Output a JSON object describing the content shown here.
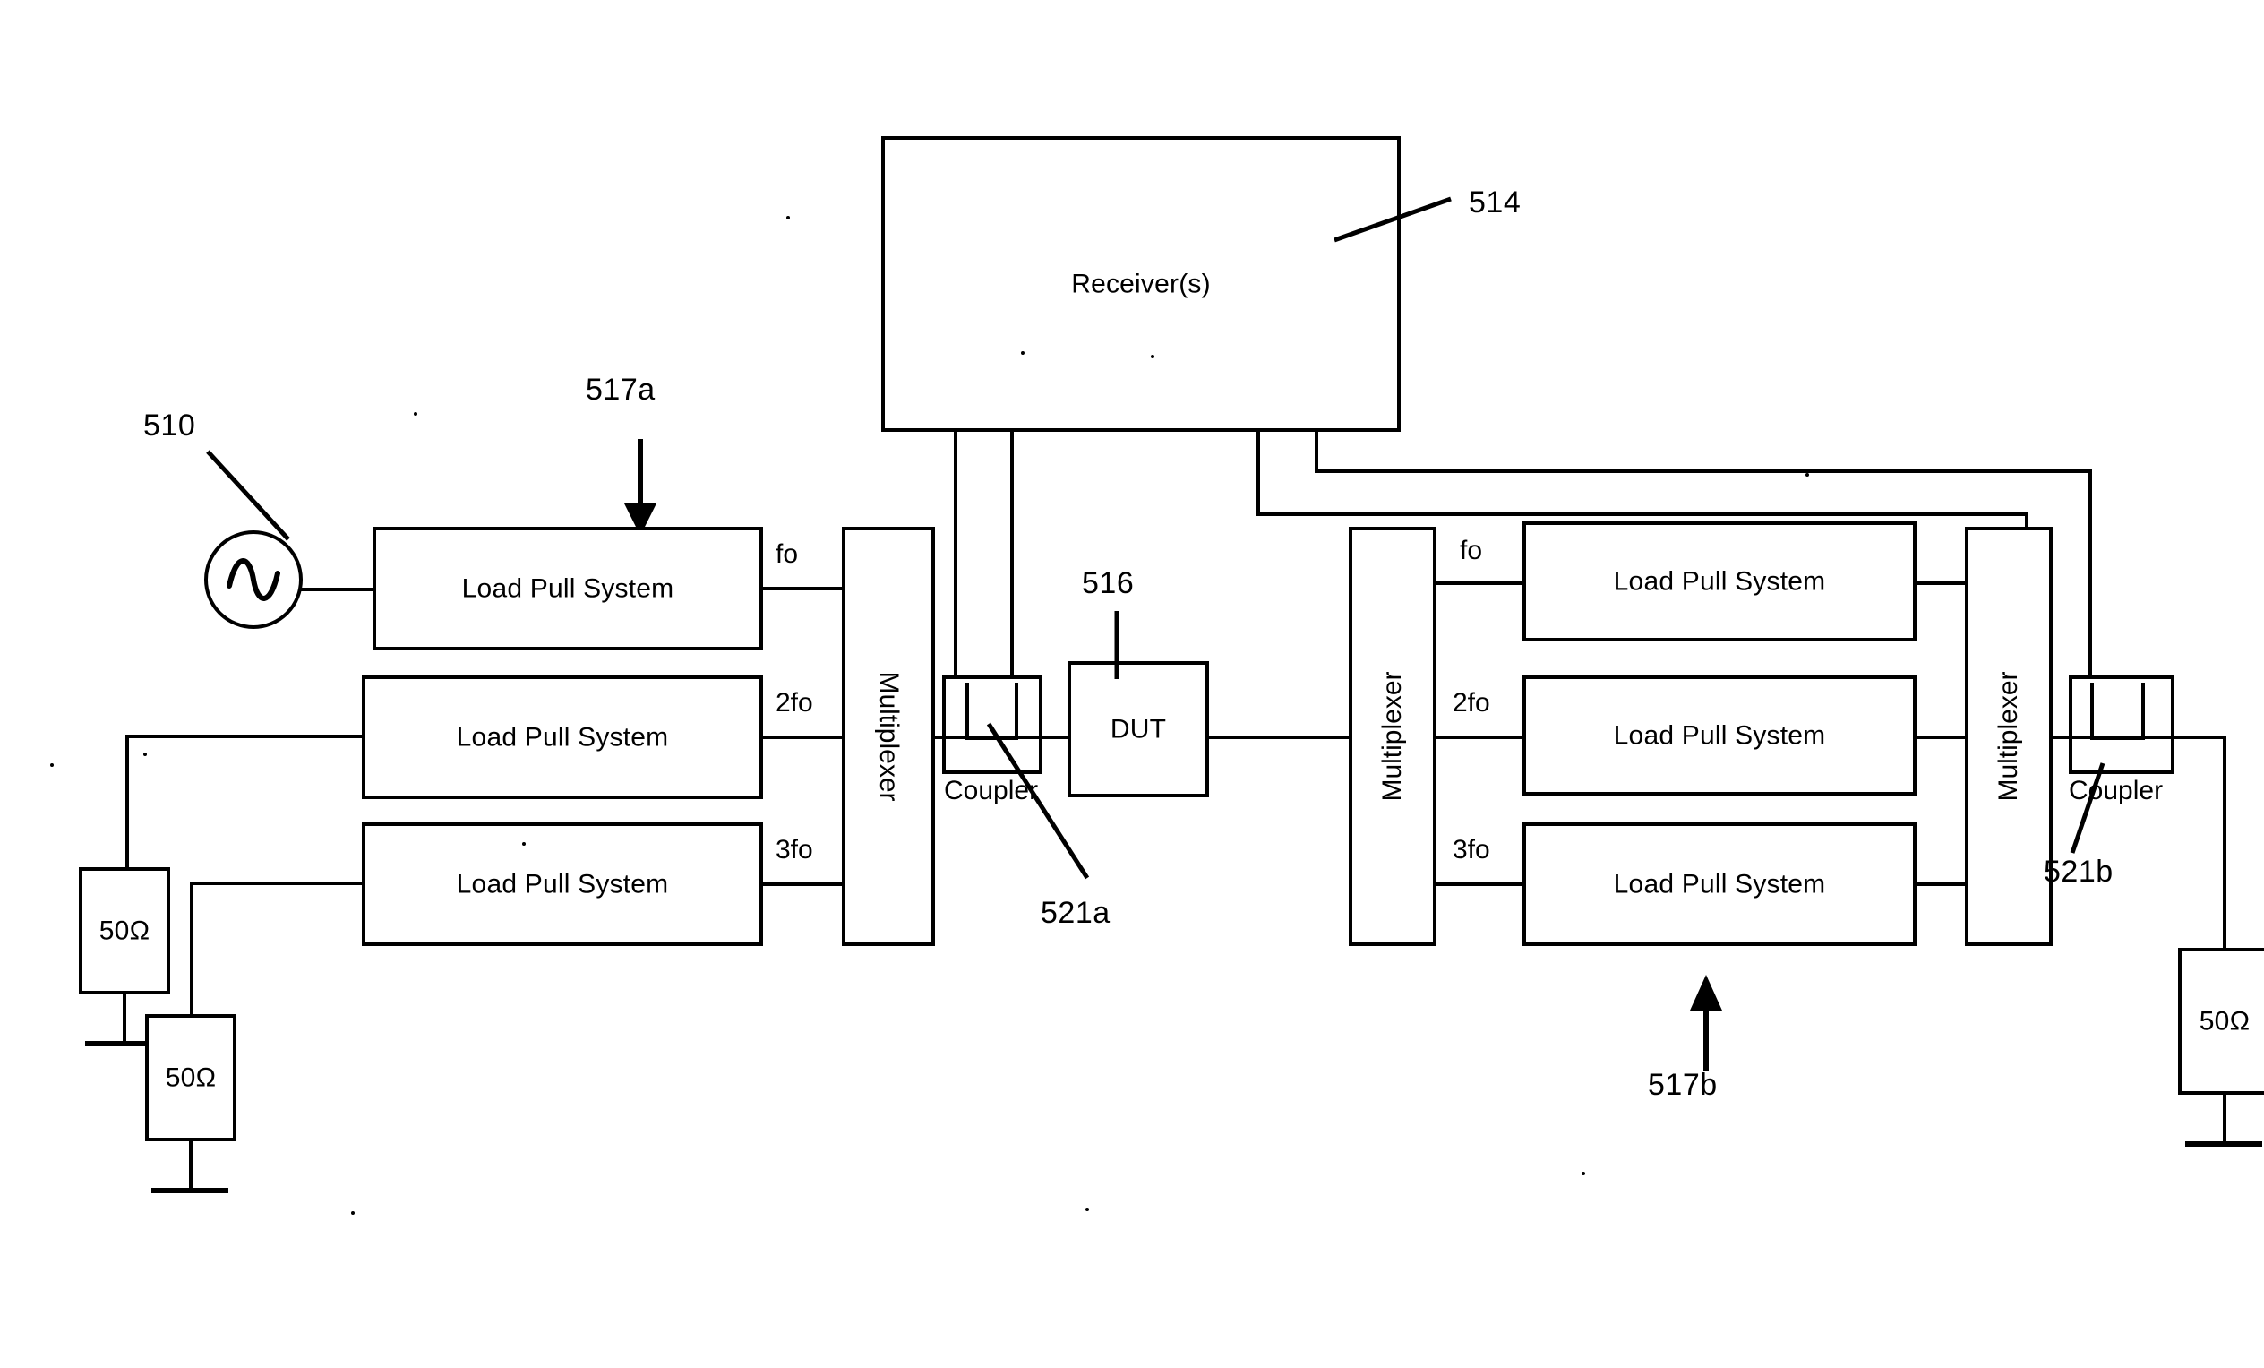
{
  "figure": {
    "kind": "patent-block-diagram",
    "reference_numerals": [
      {
        "id": "510",
        "label": "510",
        "points_to": "signal-source"
      },
      {
        "id": "514",
        "label": "514",
        "points_to": "receivers-block"
      },
      {
        "id": "516",
        "label": "516",
        "points_to": "dut-block"
      },
      {
        "id": "517a",
        "label": "517a",
        "points_to": "source-side-load-pull-group"
      },
      {
        "id": "517b",
        "label": "517b",
        "points_to": "load-side-load-pull-group"
      },
      {
        "id": "521a",
        "label": "521a",
        "points_to": "input-coupler"
      },
      {
        "id": "521b",
        "label": "521b",
        "points_to": "output-coupler"
      }
    ]
  },
  "blocks": {
    "receivers": {
      "label": "Receiver(s)"
    },
    "dut": {
      "label": "DUT"
    },
    "coupler_in": {
      "label": "Coupler"
    },
    "coupler_out": {
      "label": "Coupler"
    },
    "multiplexer_left": {
      "label": "Multiplexer"
    },
    "multiplexer_right": {
      "label": "Multiplexer"
    },
    "source": {
      "label": "",
      "icon": "sine-source-icon"
    }
  },
  "source_side": {
    "group_tag": "517a",
    "load_pull_systems": [
      {
        "label": "Load Pull System",
        "port": "fo"
      },
      {
        "label": "Load Pull System",
        "port": "2fo"
      },
      {
        "label": "Load Pull System",
        "port": "3fo"
      }
    ],
    "terminations": [
      {
        "label": "50Ω"
      },
      {
        "label": "50Ω"
      }
    ]
  },
  "load_side": {
    "group_tag": "517b",
    "load_pull_systems": [
      {
        "label": "Load Pull System",
        "port": "fo"
      },
      {
        "label": "Load Pull System",
        "port": "2fo"
      },
      {
        "label": "Load Pull System",
        "port": "3fo"
      }
    ],
    "terminations": [
      {
        "label": "50Ω"
      }
    ]
  },
  "colors": {
    "ink": "#000000",
    "paper": "#ffffff"
  }
}
